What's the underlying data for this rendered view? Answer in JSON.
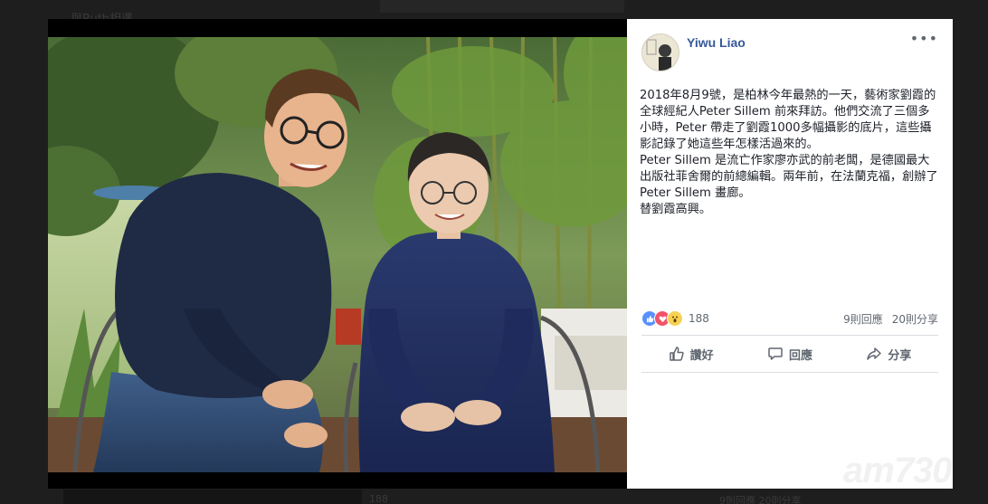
{
  "background": {
    "top_text": "與Ruth相遇",
    "bottom_mid_text": "188",
    "bottom_right_text": "9則回應 20則分享"
  },
  "post": {
    "author": "Yiwu Liao",
    "more_label": "•••",
    "paragraphs": [
      "2018年8月9號，是柏林今年最熱的一天，藝術家劉霞的全球經紀人Peter Sillem 前來拜訪。他們交流了三個多小時，Peter 帶走了劉霞1000多幅攝影的底片，這些攝影記錄了她這些年怎樣活過來的。",
      "Peter Sillem 是流亡作家廖亦武的前老闆，是德國最大出版社菲舍爾的前總編輯。兩年前，在法蘭克福，創辦了Peter Sillem 畫廊。",
      "替劉霞高興。"
    ],
    "reaction_count": "188",
    "comments_count": "9則回應",
    "shares_count": "20則分享",
    "actions": {
      "like": "讚好",
      "comment": "回應",
      "share": "分享"
    }
  },
  "watermark": {
    "logo_text": "am730"
  },
  "colors": {
    "author": "#365899",
    "like_blue": "#5890ff",
    "love_red": "#f25268",
    "wow_yellow": "#f7d154",
    "muted_text": "#606770"
  },
  "icons": [
    "more-options-icon",
    "like-reaction-icon",
    "love-reaction-icon",
    "wow-reaction-icon",
    "thumbs-up-icon",
    "comment-icon",
    "share-icon"
  ]
}
